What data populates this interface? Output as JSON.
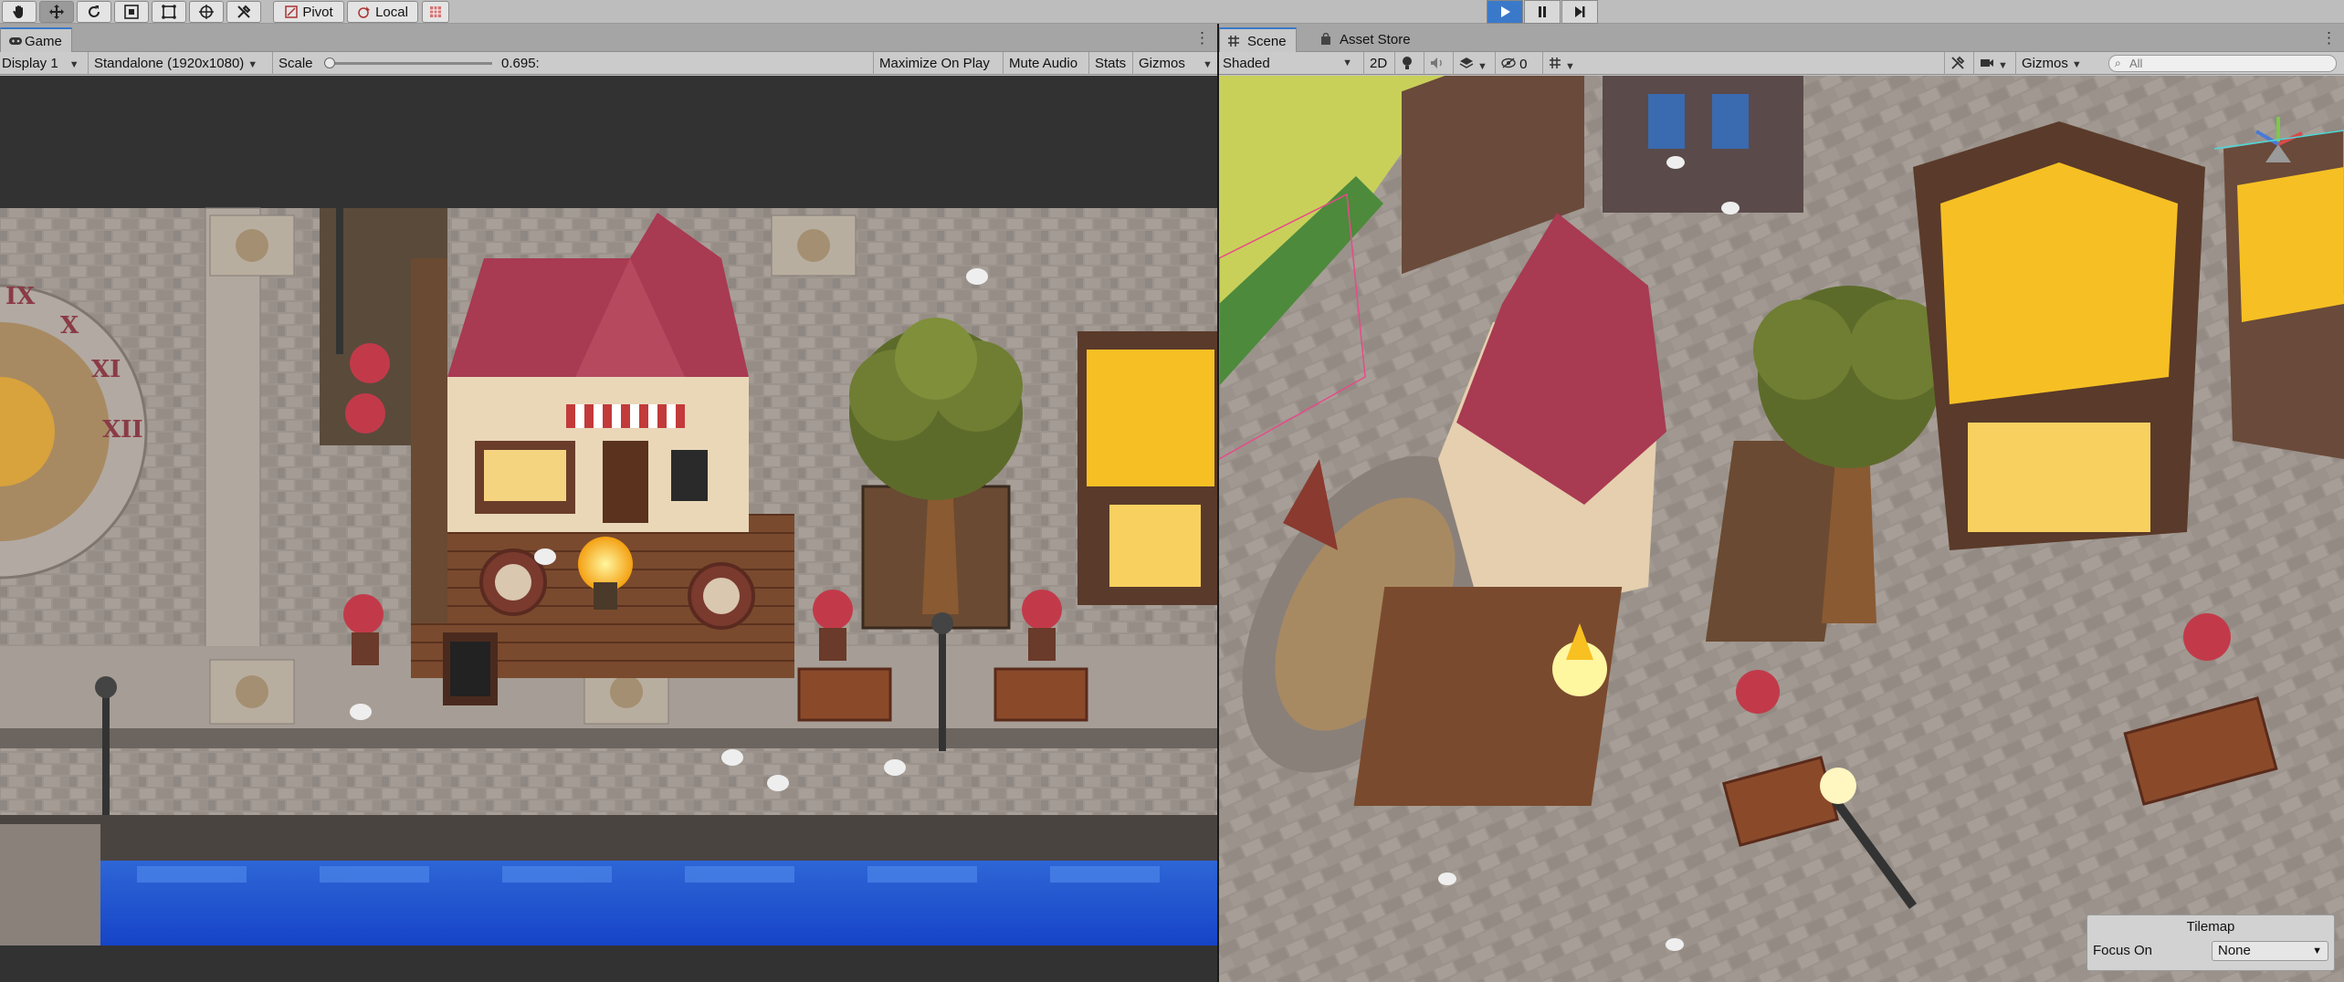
{
  "toolbar": {
    "tools": [
      "hand-icon",
      "move-icon",
      "rotate-icon",
      "scale-icon",
      "rect-icon",
      "transform-icon",
      "custom-tools-icon"
    ],
    "pivot_label": "Pivot",
    "local_label": "Local",
    "play_controls": [
      "play-icon",
      "pause-icon",
      "step-icon"
    ],
    "play_active": true
  },
  "game_panel": {
    "tab_label": "Game",
    "display_label": "Display 1",
    "resolution_label": "Standalone (1920x1080)",
    "scale_label": "Scale",
    "scale_value": "0.695:",
    "scale_fraction": 0.02,
    "buttons": {
      "maximize": "Maximize On Play",
      "mute": "Mute Audio",
      "stats": "Stats",
      "gizmos": "Gizmos"
    }
  },
  "scene_panel": {
    "tabs": {
      "scene": "Scene",
      "asset_store": "Asset Store"
    },
    "shading_mode": "Shaded",
    "mode_2d": "2D",
    "hidden_count": "0",
    "gizmos_label": "Gizmos",
    "search_placeholder": "All",
    "overlay": {
      "title": "Tilemap",
      "focus_label": "Focus On",
      "focus_value": "None"
    }
  },
  "colors": {
    "accent": "#3a79c9",
    "water": "#1c56d8",
    "stone": "#9c948e",
    "roof": "#a83a52"
  }
}
